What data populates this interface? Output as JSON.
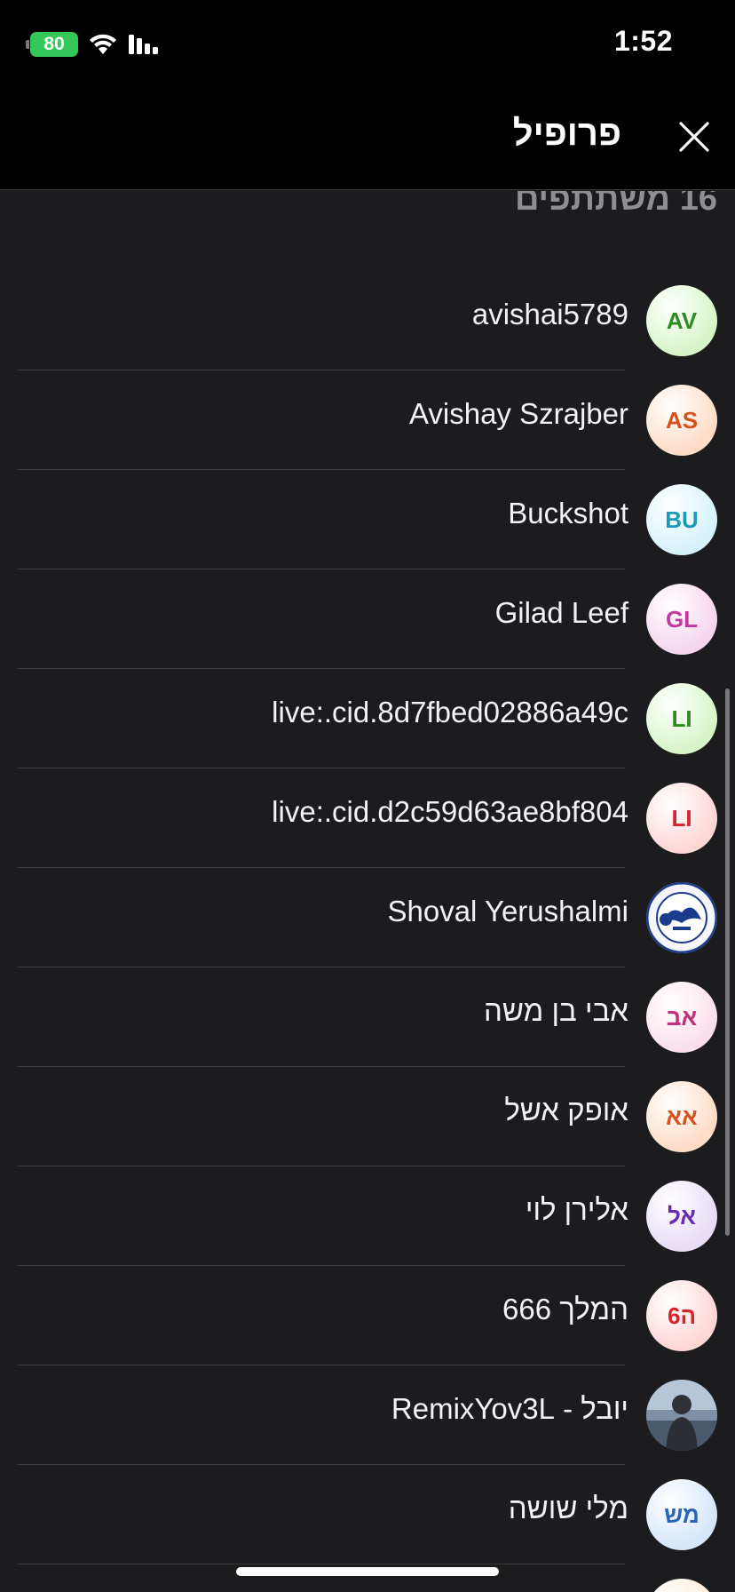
{
  "status_bar": {
    "battery": "80",
    "time": "1:52"
  },
  "nav": {
    "title": "פרופיל"
  },
  "section": {
    "header": "16 משתתפים"
  },
  "participants": [
    {
      "name": "avishai5789",
      "initials": "AV",
      "bg": "#d7f6c8",
      "fg": "#2e8b1f",
      "dir": "ltr"
    },
    {
      "name": "Avishay Szrajber",
      "initials": "AS",
      "bg": "#ffdcc6",
      "fg": "#d4521f",
      "dir": "ltr"
    },
    {
      "name": "Buckshot",
      "initials": "BU",
      "bg": "#d5f2fb",
      "fg": "#1a9ab6",
      "dir": "ltr"
    },
    {
      "name": "Gilad Leef",
      "initials": "GL",
      "bg": "#f6d5ee",
      "fg": "#c2389e",
      "dir": "ltr"
    },
    {
      "name": "live:.cid.8d7fbed02886a49c",
      "initials": "LI",
      "bg": "#d7f6c8",
      "fg": "#2e8b1f",
      "dir": "ltr"
    },
    {
      "name": "live:.cid.d2c59d63ae8bf804",
      "initials": "LI",
      "bg": "#ffd6d6",
      "fg": "#d6232d",
      "dir": "ltr"
    },
    {
      "name": "Shoval Yerushalmi",
      "initials": "",
      "bg": "#e9eef7",
      "fg": "#1d3b8c",
      "dir": "ltr",
      "photo": "emblem"
    },
    {
      "name": "אבי בן משה",
      "initials": "אב",
      "bg": "#fbe0ec",
      "fg": "#c2307a",
      "dir": "rtl"
    },
    {
      "name": "אופק אשל",
      "initials": "אא",
      "bg": "#ffdcc6",
      "fg": "#d4521f",
      "dir": "rtl"
    },
    {
      "name": "אלירן לוי",
      "initials": "אל",
      "bg": "#e8dcf7",
      "fg": "#6a2bb0",
      "dir": "rtl"
    },
    {
      "name": "המלך 666",
      "initials": "ה6",
      "bg": "#ffd6d6",
      "fg": "#d6232d",
      "dir": "rtl"
    },
    {
      "name": "יובל - RemixYov3L",
      "initials": "",
      "bg": "#6d7f93",
      "fg": "#ffffff",
      "dir": "rtl",
      "photo": "person"
    },
    {
      "name": "מלי שושה",
      "initials": "מש",
      "bg": "#d5e6fb",
      "fg": "#2a63b8",
      "dir": "rtl"
    },
    {
      "name": "",
      "initials": "",
      "bg": "#ffe8d6",
      "fg": "#d4521f",
      "dir": "rtl"
    }
  ]
}
